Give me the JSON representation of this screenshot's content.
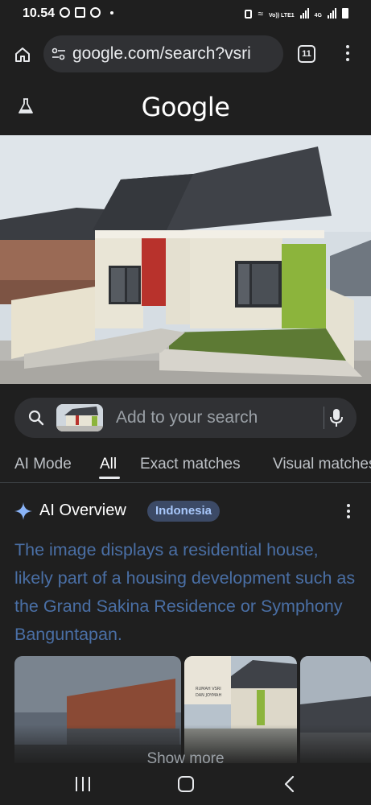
{
  "status_bar": {
    "time": "10.54",
    "network_label": "4G",
    "volte_label": "Vo)) LTE1"
  },
  "browser": {
    "url": "google.com/search?vsri",
    "tab_count": "11"
  },
  "google": {
    "logo_text": "Google"
  },
  "search": {
    "placeholder": "Add to your search"
  },
  "filters": {
    "tabs": [
      {
        "label": "AI Mode"
      },
      {
        "label": "All"
      },
      {
        "label": "Exact matches"
      },
      {
        "label": "Visual matches"
      }
    ],
    "active": "All"
  },
  "ai_overview": {
    "title": "AI Overview",
    "badge": "Indonesia",
    "text": "The image displays a residential house, likely part of a housing development such as the Grand Sakina Residence or Symphony Banguntapan."
  },
  "images": {
    "tile2_caption_line1": "RUMAH VSRI",
    "tile2_caption_line2": "DAN JOYMAH"
  },
  "show_more": {
    "label": "Show more"
  },
  "colors": {
    "background": "#1f1f1f",
    "accent_link": "#4a6fa5",
    "badge_bg": "#3c4a66",
    "badge_text": "#a8c7fa",
    "house_red": "#b8322c",
    "house_green": "#8cb43c"
  },
  "icons": {
    "home": "home-icon",
    "tune": "tune-icon",
    "tabs": "tabs-icon",
    "menu": "more-vert-icon",
    "labs": "flask-icon",
    "search": "search-icon",
    "mic": "mic-icon",
    "sparkle": "sparkle-icon",
    "nav_recent": "recents-icon",
    "nav_home": "nav-home-icon",
    "nav_back": "back-icon"
  }
}
